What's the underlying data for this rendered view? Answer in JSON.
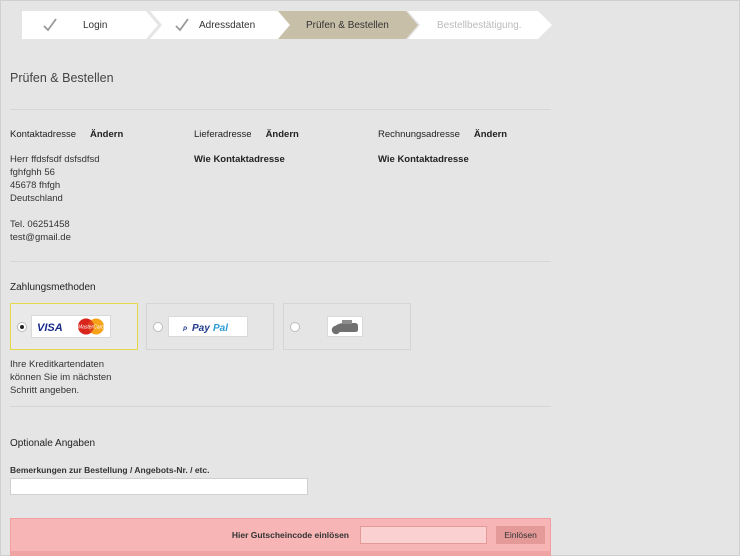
{
  "steps": [
    {
      "label": "Login",
      "state": "done"
    },
    {
      "label": "Adressdaten",
      "state": "done"
    },
    {
      "label": "Prüfen & Bestellen",
      "state": "active"
    },
    {
      "label": "Bestellbestätigung.",
      "state": "pending"
    }
  ],
  "page_title": "Prüfen & Bestellen",
  "addresses": {
    "contact": {
      "heading": "Kontaktadresse",
      "change_label": "Ändern",
      "lines": [
        "Herr ffdsfsdf dsfsdfsd",
        "fghfghh 56",
        "45678 fhfgh",
        "Deutschland"
      ],
      "phone": "Tel. 06251458",
      "email": "test@gmail.de"
    },
    "delivery": {
      "heading": "Lieferadresse",
      "change_label": "Ändern",
      "value": "Wie Kontaktadresse"
    },
    "billing": {
      "heading": "Rechnungsadresse",
      "change_label": "Ändern",
      "value": "Wie Kontaktadresse"
    }
  },
  "payment": {
    "heading": "Zahlungsmethoden",
    "options": [
      {
        "id": "creditcard",
        "logos": [
          "VISA",
          "MasterCard"
        ],
        "selected": true
      },
      {
        "id": "paypal",
        "logos": [
          "PayPal"
        ],
        "selected": false
      },
      {
        "id": "cash",
        "logos": [
          "hand-money-icon"
        ],
        "selected": false
      }
    ],
    "note": [
      "Ihre Kreditkartendaten",
      "können Sie im nächsten",
      "Schritt angeben."
    ]
  },
  "optional": {
    "heading": "Optionale Angaben",
    "remarks_label": "Bemerkungen zur Bestellung / Angebots-Nr. / etc.",
    "remarks_value": ""
  },
  "coupon": {
    "label": "Hier Gutscheincode einlösen",
    "value": "",
    "button": "Einlösen"
  },
  "colors": {
    "step_done": "#ffffff",
    "step_active": "#c8bfa8",
    "step_pending": "#ffffff",
    "selected_border": "#e7d84a",
    "coupon_bg": "#f7b5b5",
    "paypal_blue": "#1f3a8a",
    "mastercard_red": "#d9261c",
    "mastercard_orange": "#f7a21b"
  }
}
